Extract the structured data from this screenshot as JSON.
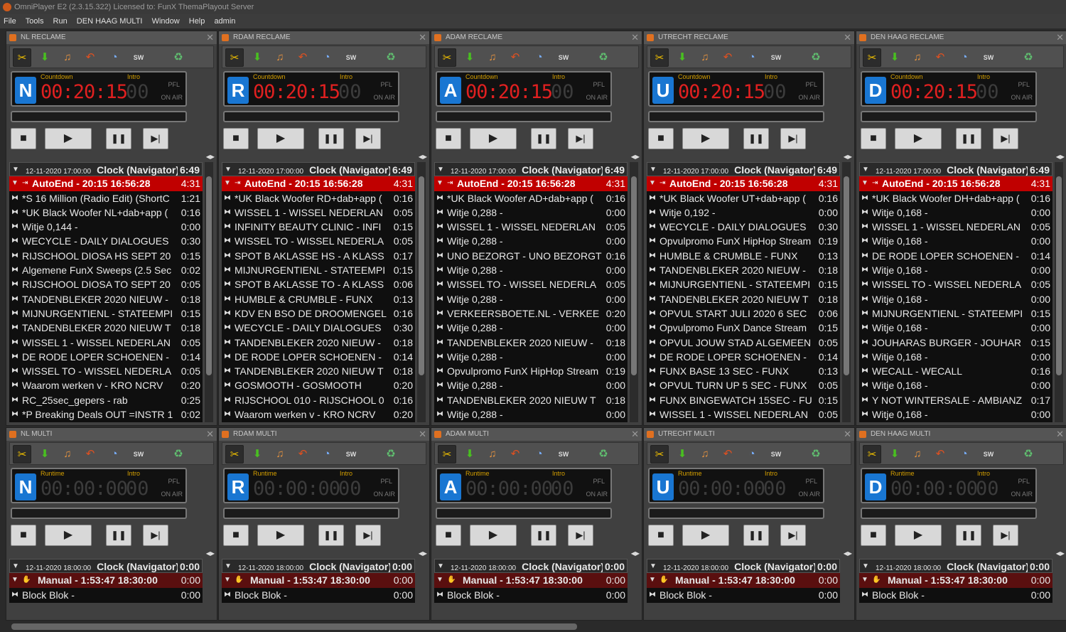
{
  "app": {
    "title": "OmniPlayer E2 (2.3.15.322) Licensed to: FunX ThemaPlayout Server"
  },
  "menu": [
    "File",
    "Tools",
    "Run",
    "DEN HAAG MULTI",
    "Window",
    "Help",
    "admin"
  ],
  "icons": {
    "toolbar": [
      "scissors-icon",
      "arrow-down-icon",
      "ear-icon",
      "undo-arrow-icon",
      "clock-icon",
      "sw-icon",
      "recycle-bin-icon"
    ],
    "controls": [
      "stop-icon",
      "play-icon",
      "pause-icon",
      "skip-next-icon"
    ]
  },
  "colors": {
    "countdown": "#e02020",
    "runtime": "#3c3c3c",
    "autoend": "#c00000",
    "manual": "#5a0f0f",
    "logo": "#1976d2"
  },
  "sw_label": "SW",
  "pfl_label": "PFL",
  "onair_label": "ON AIR",
  "rows": [
    {
      "players": [
        {
          "title": "NL RECLAME",
          "logo": "N",
          "counter_label": "Countdown",
          "counter": "00:20:15",
          "intro_label": "Intro",
          "intro": "00",
          "header": {
            "date": "12-11-2020 17:00:00",
            "title": "Clock (Navigator)",
            "dur": "6:49"
          },
          "status": {
            "title": "AutoEnd - 20:15 16:56:28",
            "dur": "4:31"
          },
          "items": [
            [
              "*S 16 Million (Radio Edit) (ShortC",
              "1:21"
            ],
            [
              "*UK Black Woofer NL+dab+app (",
              "0:16"
            ],
            [
              "Witje 0,144 -",
              "0:00"
            ],
            [
              "WECYCLE - DAILY DIALOGUES",
              "0:30"
            ],
            [
              "RIJSCHOOL DIOSA HS SEPT 20",
              "0:15"
            ],
            [
              "Algemene FunX Sweeps (2.5 Sec",
              "0:02"
            ],
            [
              "RIJSCHOOL DIOSA TO SEPT 20",
              "0:05"
            ],
            [
              "TANDENBLEKER 2020 NIEUW -",
              "0:18"
            ],
            [
              "MIJNURGENTIENL - STATEEMPI",
              "0:15"
            ],
            [
              "TANDENBLEKER 2020 NIEUW T",
              "0:18"
            ],
            [
              "WISSEL 1 - WISSEL NEDERLAN",
              "0:05"
            ],
            [
              "DE RODE LOPER SCHOENEN -",
              "0:14"
            ],
            [
              "WISSEL TO - WISSEL NEDERLA",
              "0:05"
            ],
            [
              "Waarom werken v - KRO NCRV",
              "0:20"
            ],
            [
              "RC_25sec_gepers - rab",
              "0:25"
            ],
            [
              "*P Breaking Deals OUT =INSTR 1",
              "0:02"
            ]
          ]
        },
        {
          "title": "RDAM RECLAME",
          "logo": "R",
          "counter_label": "Countdown",
          "counter": "00:20:15",
          "intro_label": "Intro",
          "intro": "00",
          "header": {
            "date": "12-11-2020 17:00:00",
            "title": "Clock (Navigator)",
            "dur": "6:49"
          },
          "status": {
            "title": "AutoEnd - 20:15 16:56:28",
            "dur": "4:31"
          },
          "items": [
            [
              "*UK Black Woofer RD+dab+app (",
              "0:16"
            ],
            [
              "WISSEL 1 - WISSEL NEDERLAN",
              "0:05"
            ],
            [
              "INFINITY BEAUTY CLINIC - INFI",
              "0:15"
            ],
            [
              "WISSEL TO - WISSEL NEDERLA",
              "0:05"
            ],
            [
              "SPOT B AKLASSE HS - A KLASS",
              "0:17"
            ],
            [
              "MIJNURGENTIENL - STATEEMPI",
              "0:15"
            ],
            [
              "SPOT B AKLASSE TO - A KLASS",
              "0:06"
            ],
            [
              "HUMBLE & CRUMBLE - FUNX",
              "0:13"
            ],
            [
              "KDV EN BSO DE DROOMENGEL",
              "0:16"
            ],
            [
              "WECYCLE - DAILY DIALOGUES",
              "0:30"
            ],
            [
              "TANDENBLEKER 2020 NIEUW -",
              "0:18"
            ],
            [
              "DE RODE LOPER SCHOENEN -",
              "0:14"
            ],
            [
              "TANDENBLEKER 2020 NIEUW T",
              "0:18"
            ],
            [
              "GOSMOOTH - GOSMOOTH",
              "0:20"
            ],
            [
              "RIJSCHOOL 010 - RIJSCHOOL 0",
              "0:16"
            ],
            [
              "Waarom werken v - KRO NCRV",
              "0:20"
            ]
          ]
        },
        {
          "title": "ADAM RECLAME",
          "logo": "A",
          "counter_label": "Countdown",
          "counter": "00:20:15",
          "intro_label": "Intro",
          "intro": "00",
          "header": {
            "date": "12-11-2020 17:00:00",
            "title": "Clock (Navigator)",
            "dur": "6:49"
          },
          "status": {
            "title": "AutoEnd - 20:15 16:56:28",
            "dur": "4:31"
          },
          "items": [
            [
              "*UK Black Woofer AD+dab+app (",
              "0:16"
            ],
            [
              "Witje 0,288 -",
              "0:00"
            ],
            [
              "WISSEL 1 - WISSEL NEDERLAN",
              "0:05"
            ],
            [
              "Witje 0,288 -",
              "0:00"
            ],
            [
              "UNO BEZORGT - UNO BEZORGT",
              "0:16"
            ],
            [
              "Witje 0,288 -",
              "0:00"
            ],
            [
              "WISSEL TO - WISSEL NEDERLA",
              "0:05"
            ],
            [
              "Witje 0,288 -",
              "0:00"
            ],
            [
              "VERKEERSBOETE.NL - VERKEE",
              "0:20"
            ],
            [
              "Witje 0,288 -",
              "0:00"
            ],
            [
              "TANDENBLEKER 2020 NIEUW -",
              "0:18"
            ],
            [
              "Witje 0,288 -",
              "0:00"
            ],
            [
              "Opvulpromo FunX HipHop Stream",
              "0:19"
            ],
            [
              "Witje 0,288 -",
              "0:00"
            ],
            [
              "TANDENBLEKER 2020 NIEUW T",
              "0:18"
            ],
            [
              "Witje 0,288 -",
              "0:00"
            ]
          ]
        },
        {
          "title": "UTRECHT RECLAME",
          "logo": "U",
          "counter_label": "Countdown",
          "counter": "00:20:15",
          "intro_label": "Intro",
          "intro": "00",
          "header": {
            "date": "12-11-2020 17:00:00",
            "title": "Clock (Navigator)",
            "dur": "6:49"
          },
          "status": {
            "title": "AutoEnd - 20:15 16:56:28",
            "dur": "4:31"
          },
          "items": [
            [
              "*UK Black Woofer UT+dab+app (",
              "0:16"
            ],
            [
              "Witje 0,192 -",
              "0:00"
            ],
            [
              "WECYCLE - DAILY DIALOGUES",
              "0:30"
            ],
            [
              "Opvulpromo FunX HipHop Stream",
              "0:19"
            ],
            [
              "HUMBLE & CRUMBLE - FUNX",
              "0:13"
            ],
            [
              "TANDENBLEKER 2020 NIEUW -",
              "0:18"
            ],
            [
              "MIJNURGENTIENL - STATEEMPI",
              "0:15"
            ],
            [
              "TANDENBLEKER 2020 NIEUW T",
              "0:18"
            ],
            [
              "OPVUL START JULI 2020 6 SEC",
              "0:06"
            ],
            [
              "Opvulpromo FunX Dance Stream",
              "0:15"
            ],
            [
              "OPVUL JOUW STAD ALGEMEEN",
              "0:05"
            ],
            [
              "DE RODE LOPER SCHOENEN -",
              "0:14"
            ],
            [
              "FUNX BASE 13 SEC - FUNX",
              "0:13"
            ],
            [
              "OPVUL TURN UP 5 SEC - FUNX",
              "0:05"
            ],
            [
              "FUNX BINGEWATCH 15SEC - FU",
              "0:15"
            ],
            [
              "WISSEL 1 - WISSEL NEDERLAN",
              "0:05"
            ]
          ]
        },
        {
          "title": "DEN HAAG RECLAME",
          "logo": "D",
          "counter_label": "Countdown",
          "counter": "00:20:15",
          "intro_label": "Intro",
          "intro": "00",
          "header": {
            "date": "12-11-2020 17:00:00",
            "title": "Clock (Navigator)",
            "dur": "6:49"
          },
          "status": {
            "title": "AutoEnd - 20:15 16:56:28",
            "dur": "4:31"
          },
          "items": [
            [
              "*UK Black Woofer DH+dab+app (",
              "0:16"
            ],
            [
              "Witje 0,168 -",
              "0:00"
            ],
            [
              "WISSEL 1 - WISSEL NEDERLAN",
              "0:05"
            ],
            [
              "Witje 0,168 -",
              "0:00"
            ],
            [
              "DE RODE LOPER SCHOENEN -",
              "0:14"
            ],
            [
              "Witje 0,168 -",
              "0:00"
            ],
            [
              "WISSEL TO - WISSEL NEDERLA",
              "0:05"
            ],
            [
              "Witje 0,168 -",
              "0:00"
            ],
            [
              "MIJNURGENTIENL - STATEEMPI",
              "0:15"
            ],
            [
              "Witje 0,168 -",
              "0:00"
            ],
            [
              "JOUHARAS BURGER - JOUHAR",
              "0:15"
            ],
            [
              "Witje 0,168 -",
              "0:00"
            ],
            [
              "WECALL - WECALL",
              "0:16"
            ],
            [
              "Witje 0,168 -",
              "0:00"
            ],
            [
              "Y NOT WINTERSALE - AMBIANZ",
              "0:17"
            ],
            [
              "Witje 0,168 -",
              "0:00"
            ]
          ]
        }
      ]
    },
    {
      "players": [
        {
          "title": "NL MULTI",
          "logo": "N",
          "counter_label": "Runtime",
          "counter": "00:00:00",
          "intro_label": "Intro",
          "intro": "00",
          "header": {
            "date": "12-11-2020 18:00:00",
            "title": "Clock (Navigator)",
            "dur": "0:00"
          },
          "status": {
            "title": "Manual - 1:53:47 18:30:00",
            "dur": "0:00"
          },
          "items": [
            [
              "Block Blok -",
              "0:00"
            ]
          ]
        },
        {
          "title": "RDAM MULTI",
          "logo": "R",
          "counter_label": "Runtime",
          "counter": "00:00:00",
          "intro_label": "Intro",
          "intro": "00",
          "header": {
            "date": "12-11-2020 18:00:00",
            "title": "Clock (Navigator)",
            "dur": "0:00"
          },
          "status": {
            "title": "Manual - 1:53:47 18:30:00",
            "dur": "0:00"
          },
          "items": [
            [
              "Block Blok -",
              "0:00"
            ]
          ]
        },
        {
          "title": "ADAM MULTI",
          "logo": "A",
          "counter_label": "Runtime",
          "counter": "00:00:00",
          "intro_label": "Intro",
          "intro": "00",
          "header": {
            "date": "12-11-2020 18:00:00",
            "title": "Clock (Navigator)",
            "dur": "0:00"
          },
          "status": {
            "title": "Manual - 1:53:47 18:30:00",
            "dur": "0:00"
          },
          "items": [
            [
              "Block Blok -",
              "0:00"
            ]
          ]
        },
        {
          "title": "UTRECHT MULTI",
          "logo": "U",
          "counter_label": "Runtime",
          "counter": "00:00:00",
          "intro_label": "Intro",
          "intro": "00",
          "header": {
            "date": "12-11-2020 18:00:00",
            "title": "Clock (Navigator)",
            "dur": "0:00"
          },
          "status": {
            "title": "Manual - 1:53:47 18:30:00",
            "dur": "0:00"
          },
          "items": [
            [
              "Block Blok -",
              "0:00"
            ]
          ]
        },
        {
          "title": "DEN HAAG MULTI",
          "logo": "D",
          "counter_label": "Runtime",
          "counter": "00:00:00",
          "intro_label": "Intro",
          "intro": "00",
          "header": {
            "date": "12-11-2020 18:00:00",
            "title": "Clock (Navigator)",
            "dur": "0:00"
          },
          "status": {
            "title": "Manual - 1:53:47 18:30:00",
            "dur": "0:00"
          },
          "items": [
            [
              "Block Blok -",
              "0:00"
            ]
          ]
        }
      ]
    }
  ]
}
